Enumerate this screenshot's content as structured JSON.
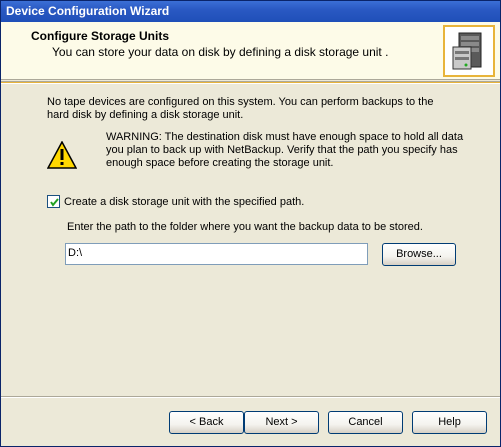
{
  "window": {
    "title": "Device Configuration Wizard"
  },
  "header": {
    "title": "Configure Storage Units",
    "subtitle": "You can store your data on disk by defining a disk storage unit .",
    "icon": "server-icon"
  },
  "body": {
    "info_text": "No tape devices are configured on this system. You can perform backups to the hard disk by defining a disk storage unit.",
    "warning_text": "WARNING: The destination disk must have enough space to hold all data you plan to back up with NetBackup. Verify that the path you specify has enough space before creating the storage unit.",
    "warning_icon": "warning-icon",
    "checkbox_label": "Create a disk storage unit with the specified path.",
    "checkbox_checked": true,
    "path_label": "Enter the path to the folder where you want the backup data to be stored.",
    "path_value": "D:\\",
    "browse_label": "Browse..."
  },
  "footer": {
    "back_label": "< Back",
    "next_label": "Next >",
    "cancel_label": "Cancel",
    "help_label": "Help"
  }
}
